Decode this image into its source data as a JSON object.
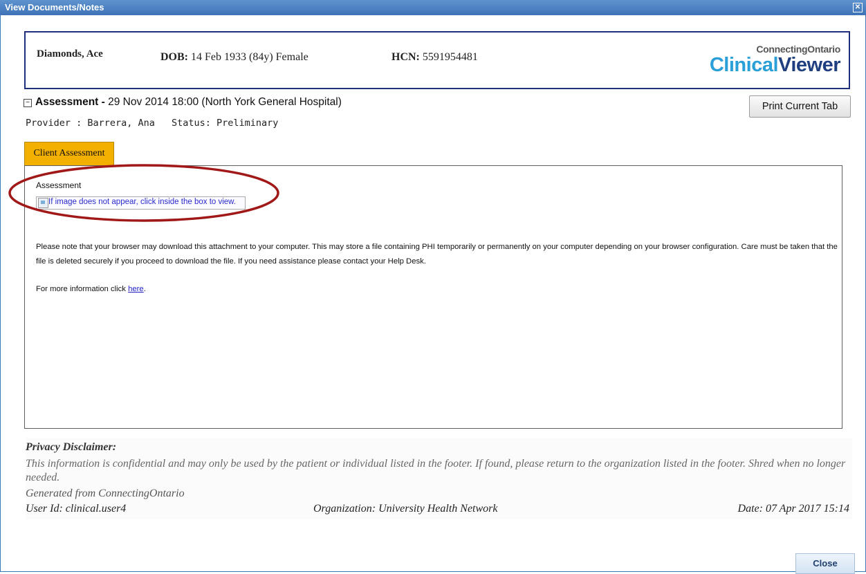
{
  "window": {
    "title": "View Documents/Notes",
    "close_glyph": "✕"
  },
  "patient": {
    "name": "Diamonds, Ace",
    "dob_label": "DOB:",
    "dob_value": "14 Feb 1933 (84y) Female",
    "hcn_label": "HCN:",
    "hcn_value": "5591954481"
  },
  "logo": {
    "top": "ConnectingOntario",
    "part1": "Clinical",
    "part2": "Viewer"
  },
  "document": {
    "toggle_glyph": "−",
    "heading_bold": "Assessment - ",
    "heading_rest": "29 Nov 2014 18:00 (North York General Hospital)",
    "provider": "Provider : Barrera, Ana",
    "status": "Status: Preliminary",
    "print_label": "Print Current Tab"
  },
  "tabs": [
    {
      "label": "Client Assessment"
    }
  ],
  "panel": {
    "field_label": "Assessment",
    "image_alt": "If image does not appear, click inside the box to view.",
    "notice": "Please note that your browser may download this attachment to your computer. This may store a file containing PHI temporarily or permanently on your computer depending on your browser configuration. Care must be taken that the file is deleted securely if you proceed to download the file. If you need assistance please contact your Help Desk.",
    "more_prefix": "For more information click ",
    "more_link": "here",
    "more_suffix": "."
  },
  "disclaimer": {
    "title": "Privacy Disclaimer:",
    "text": "This information is confidential and may only be used by the patient or individual listed in the footer. If found, please return to the organization listed in the footer. Shred when no longer needed.",
    "generated": "Generated from ConnectingOntario",
    "user": "User Id: clinical.user4",
    "organization": "Organization: University Health Network",
    "date": "Date: 07 Apr 2017 15:14"
  },
  "footer": {
    "close_label": "Close"
  },
  "colors": {
    "titlebar": "#3d73b7",
    "tab_active": "#f4b000",
    "annotation": "#a01818"
  }
}
